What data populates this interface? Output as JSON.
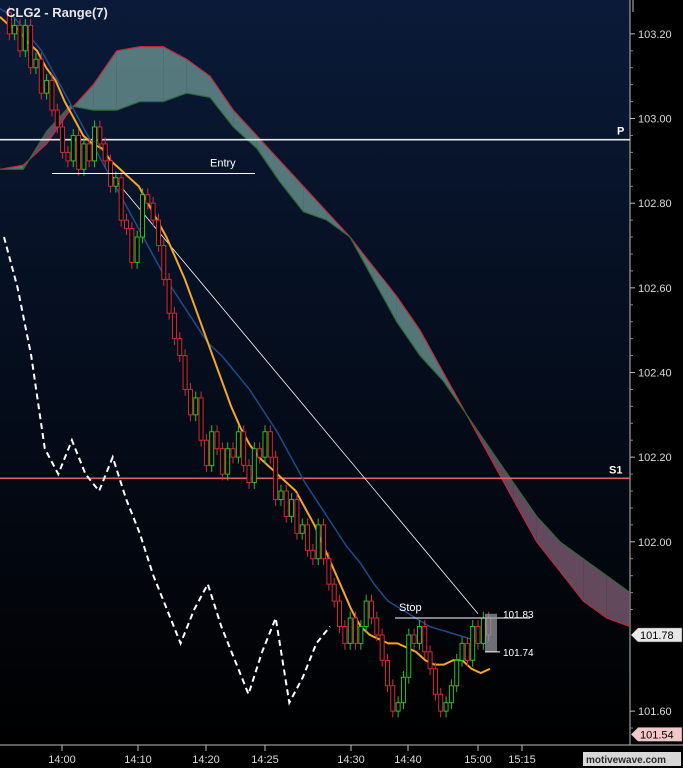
{
  "chart_data": {
    "type": "candlestick",
    "title": "CLG2 - Range(7)",
    "ylim": [
      101.52,
      103.28
    ],
    "y_ticks": [
      "103.20",
      "103.00",
      "102.80",
      "102.60",
      "102.40",
      "102.20",
      "102.00",
      "101.60"
    ],
    "x_ticks": [
      "14:00",
      "14:10",
      "14:20",
      "14:25",
      "14:30",
      "14:40",
      "15:00",
      "15:15"
    ],
    "levels": [
      {
        "label": "P",
        "value": 102.95,
        "color": "#e8e8e8"
      },
      {
        "label": "S1",
        "value": 102.15,
        "color": "#e06060"
      }
    ],
    "annotations": [
      {
        "text": "Entry",
        "value": 102.87
      },
      {
        "text": "Stop",
        "value": 101.82
      }
    ],
    "trade_box": {
      "high": "101.83",
      "low": "101.74"
    },
    "price_tags": [
      {
        "text": "101.78",
        "value": 101.78,
        "color": "#e8e8e8"
      },
      {
        "text": "101.54",
        "value": 101.545,
        "color": "#f4c8c8"
      }
    ],
    "closes": [
      103.25,
      103.2,
      103.22,
      103.16,
      103.22,
      103.12,
      103.14,
      103.06,
      103.09,
      103.02,
      102.98,
      102.92,
      102.9,
      102.96,
      102.88,
      102.94,
      102.9,
      102.98,
      102.94,
      102.9,
      102.84,
      102.86,
      102.76,
      102.74,
      102.66,
      102.72,
      102.82,
      102.8,
      102.76,
      102.7,
      102.62,
      102.54,
      102.48,
      102.44,
      102.36,
      102.3,
      102.34,
      102.24,
      102.18,
      102.26,
      102.22,
      102.16,
      102.22,
      102.2,
      102.26,
      102.18,
      102.14,
      102.22,
      102.2,
      102.26,
      102.2,
      102.1,
      102.12,
      102.06,
      102.1,
      102.02,
      102.04,
      101.98,
      101.96,
      102.04,
      101.96,
      101.9,
      101.86,
      101.8,
      101.76,
      101.82,
      101.76,
      101.8,
      101.86,
      101.82,
      101.78,
      101.72,
      101.66,
      101.6,
      101.62,
      101.68,
      101.78,
      101.76,
      101.8,
      101.74,
      101.7,
      101.64,
      101.6,
      101.62,
      101.66,
      101.72,
      101.76,
      101.72,
      101.8,
      101.76,
      101.82,
      101.78
    ],
    "ma_fast": [
      103.24,
      103.22,
      103.21,
      103.18,
      103.16,
      103.12,
      103.09,
      103.04,
      103.0,
      102.96,
      102.94,
      102.93,
      102.9,
      102.88,
      102.86,
      102.84,
      102.8,
      102.76,
      102.72,
      102.67,
      102.62,
      102.56,
      102.5,
      102.44,
      102.38,
      102.32,
      102.27,
      102.23,
      102.2,
      102.18,
      102.16,
      102.14,
      102.12,
      102.08,
      102.04,
      101.99,
      101.94,
      101.89,
      101.84,
      101.8,
      101.78,
      101.77,
      101.76,
      101.76,
      101.75,
      101.74,
      101.72,
      101.71,
      101.71,
      101.72,
      101.72,
      101.7,
      101.69,
      101.7
    ],
    "ma_slow": [
      103.26,
      103.24,
      103.2,
      103.16,
      103.1,
      103.04,
      102.98,
      102.92,
      102.86,
      102.8,
      102.74,
      102.68,
      102.62,
      102.57,
      102.52,
      102.47,
      102.44,
      102.4,
      102.36,
      102.31,
      102.26,
      102.2,
      102.14,
      102.09,
      102.04,
      101.99,
      101.95,
      101.9,
      101.86,
      101.84,
      101.82,
      101.8,
      101.79,
      101.78,
      101.77,
      101.76
    ],
    "cloud_a": [
      102.88,
      102.89,
      102.94,
      103.02,
      103.08,
      103.16,
      103.17,
      103.17,
      103.14,
      103.1,
      103.02,
      102.96,
      102.9,
      102.84,
      102.78,
      102.72,
      102.65,
      102.58,
      102.5,
      102.4,
      102.3,
      102.2,
      102.1,
      102.0,
      101.93,
      101.86,
      101.82,
      101.8
    ],
    "cloud_b": [
      102.88,
      102.88,
      102.97,
      103.03,
      103.02,
      103.02,
      103.04,
      103.04,
      103.06,
      103.05,
      102.98,
      102.93,
      102.85,
      102.78,
      102.76,
      102.72,
      102.62,
      102.52,
      102.44,
      102.38,
      102.3,
      102.22,
      102.14,
      102.06,
      102.0,
      101.96,
      101.92,
      101.88
    ],
    "lagging": [
      102.72,
      102.6,
      102.44,
      102.22,
      102.16,
      102.24,
      102.16,
      102.12,
      102.2,
      102.1,
      102.02,
      101.92,
      101.84,
      101.76,
      101.84,
      101.9,
      101.8,
      101.72,
      101.64,
      101.74,
      101.82,
      101.62,
      101.68,
      101.76,
      101.8
    ]
  },
  "icons": {
    "watermark": "motivewave-logo"
  },
  "watermark_text": "motivewave.com",
  "colors": {
    "up": "#28c028",
    "down": "#d42a3a",
    "ma_fast": "#f5a623",
    "ma_slow": "#1c4d8a",
    "cloud_up": "#6f9a96",
    "cloud_down": "#7a5a70"
  }
}
